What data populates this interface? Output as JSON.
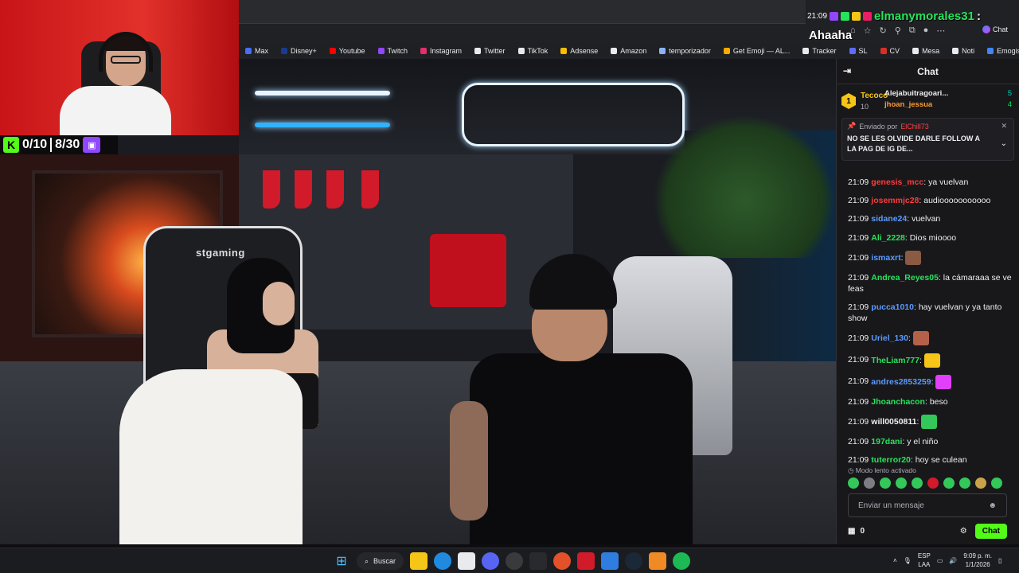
{
  "stream_overlay": {
    "time": "21:09",
    "username": "elmanymorales31",
    "colon": ":",
    "message": "Ahaaha"
  },
  "browser": {
    "chat_tab": "Chat",
    "bookmarks": [
      {
        "label": "Max",
        "color": "#4a6cf7"
      },
      {
        "label": "Disney+",
        "color": "#1a3a8f"
      },
      {
        "label": "Youtube",
        "color": "#ff0000"
      },
      {
        "label": "Twitch",
        "color": "#9146ff"
      },
      {
        "label": "Instagram",
        "color": "#e1306c"
      },
      {
        "label": "Twitter",
        "color": "#e8eaed"
      },
      {
        "label": "TikTok",
        "color": "#e8eaed"
      },
      {
        "label": "Adsense",
        "color": "#fbbc04"
      },
      {
        "label": "Amazon",
        "color": "#e8eaed"
      },
      {
        "label": "temporizador",
        "color": "#8ab4f8"
      },
      {
        "label": "Get Emoji — AL...",
        "color": "#f9ab00"
      },
      {
        "label": "Tracker",
        "color": "#e8eaed"
      },
      {
        "label": "SL",
        "color": "#5f6bff"
      },
      {
        "label": "CV",
        "color": "#d93025"
      },
      {
        "label": "Mesa",
        "color": "#e8eaed"
      },
      {
        "label": "Noti",
        "color": "#e8eaed"
      },
      {
        "label": "Emogis",
        "color": "#4285f4"
      }
    ]
  },
  "overlay_counter": {
    "kick_count": "0/10",
    "twitch_count": "8/30",
    "kick_icon": "K",
    "twitch_icon": "▣"
  },
  "video": {
    "chair_brand": "stgaming"
  },
  "chat": {
    "title": "Chat",
    "leaderboard": {
      "rank": "1",
      "top_user": "Tecoco",
      "top_points": "10",
      "users": [
        {
          "name": "Alejabuitragoari...",
          "count": "5"
        },
        {
          "name": "jhoan_jessua",
          "count": "4"
        }
      ]
    },
    "pinned": {
      "sent_by_label": "Enviado por",
      "sent_by_user": "ElChill73",
      "message": "NO SE LES OLVIDE DARLE FOLLOW A LA PAG DE IG DE..."
    },
    "messages": [
      {
        "time": "21:09",
        "user": "genesis_mcc",
        "color": "#ff3b3b",
        "text": "ya vuelvan",
        "emote": ""
      },
      {
        "time": "21:09",
        "user": "josemmjc28",
        "color": "#ff3b3b",
        "text": "audiooooooooooo",
        "emote": ""
      },
      {
        "time": "21:09",
        "user": "sidane24",
        "color": "#5b9bff",
        "text": "vuelvan",
        "emote": ""
      },
      {
        "time": "21:09",
        "user": "Ali_2228",
        "color": "#27e35b",
        "text": "Dios mioooo",
        "emote": ""
      },
      {
        "time": "21:09",
        "user": "ismaxrt",
        "color": "#5b9bff",
        "text": "",
        "emote": "#8a5a44"
      },
      {
        "time": "21:09",
        "user": "Andrea_Reyes05",
        "color": "#27e35b",
        "text": "la cámaraaa se ve feas",
        "emote": ""
      },
      {
        "time": "21:09",
        "user": "pucca1010",
        "color": "#5b9bff",
        "text": "hay vuelvan y ya tanto show",
        "emote": ""
      },
      {
        "time": "21:09",
        "user": "Uriel_130",
        "color": "#5b9bff",
        "text": "",
        "emote": "#b5614a"
      },
      {
        "time": "21:09",
        "user": "TheLiam777",
        "color": "#27e35b",
        "text": "",
        "emote": "#f5c518"
      },
      {
        "time": "21:09",
        "user": "andres2853259",
        "color": "#5b9bff",
        "text": "",
        "emote": "#e040fb"
      },
      {
        "time": "21:09",
        "user": "Jhoanchacon",
        "color": "#27e35b",
        "text": "beso",
        "emote": ""
      },
      {
        "time": "21:09",
        "user": "will0050811",
        "color": "#efeff1",
        "text": "",
        "emote": "#34c759"
      },
      {
        "time": "21:09",
        "user": "197dani",
        "color": "#27e35b",
        "text": "y el niño",
        "emote": ""
      },
      {
        "time": "21:09",
        "user": "tuterror20",
        "color": "#27e35b",
        "text": "hoy se culean",
        "emote": ""
      }
    ],
    "slow_mode": "Modo lento activado",
    "input_placeholder": "Enviar un mensaje",
    "points": "0",
    "send_label": "Chat"
  },
  "taskbar": {
    "search_label": "Buscar",
    "lang_line1": "ESP",
    "lang_line2": "LAA",
    "time": "9:09 p. m.",
    "date": "1/1/2026"
  }
}
